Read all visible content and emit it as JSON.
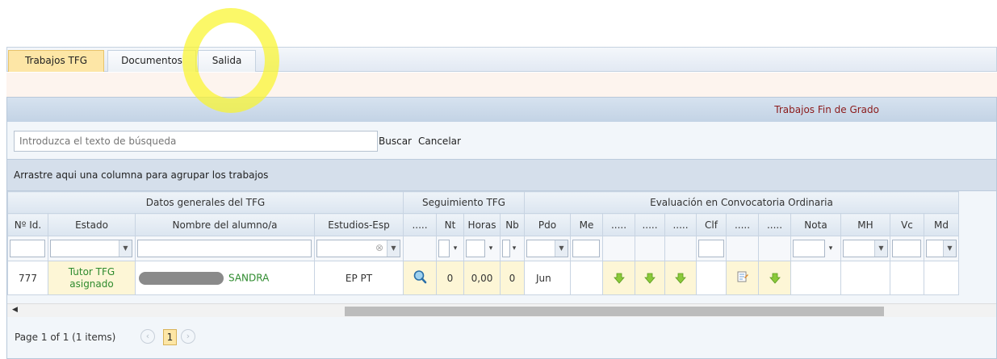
{
  "tabs": [
    "Trabajos TFG",
    "Documentos",
    "Salida"
  ],
  "grid": {
    "title": "Trabajos Fin de Grado",
    "search_placeholder": "Introduzca el texto de búsqueda",
    "search_button": "Buscar",
    "cancel_button": "Cancelar",
    "group_hint": "Arrastre aqui una columna para agrupar los trabajos",
    "group_headers": [
      "Datos generales del TFG",
      "Seguimiento TFG",
      "Evaluación en Convocatoria Ordinaria"
    ],
    "columns": [
      "Nº Id.",
      "Estado",
      "Nombre del alumno/a",
      "Estudios-Esp",
      ".....",
      "Nt",
      "Horas",
      "Nb",
      "Pdo",
      "Me",
      ".....",
      ".....",
      ".....",
      "Clf",
      ".....",
      ".....",
      "Nota",
      "MH",
      "Vc",
      "Md"
    ],
    "row": {
      "id": "777",
      "estado_line1": "Tutor TFG",
      "estado_line2": "asignado",
      "nombre": "SANDRA",
      "estudios": "EP PT",
      "nt": "0",
      "horas": "0,00",
      "nb": "0",
      "pdo": "Jun"
    },
    "pager_text": "Page 1 of 1 (1 items)",
    "current_page": "1"
  },
  "colors": {
    "active_tab": "#fde6a6",
    "title_text": "#8b1a1a",
    "status_green": "#2e8b2e",
    "highlight": "#f8f428"
  }
}
